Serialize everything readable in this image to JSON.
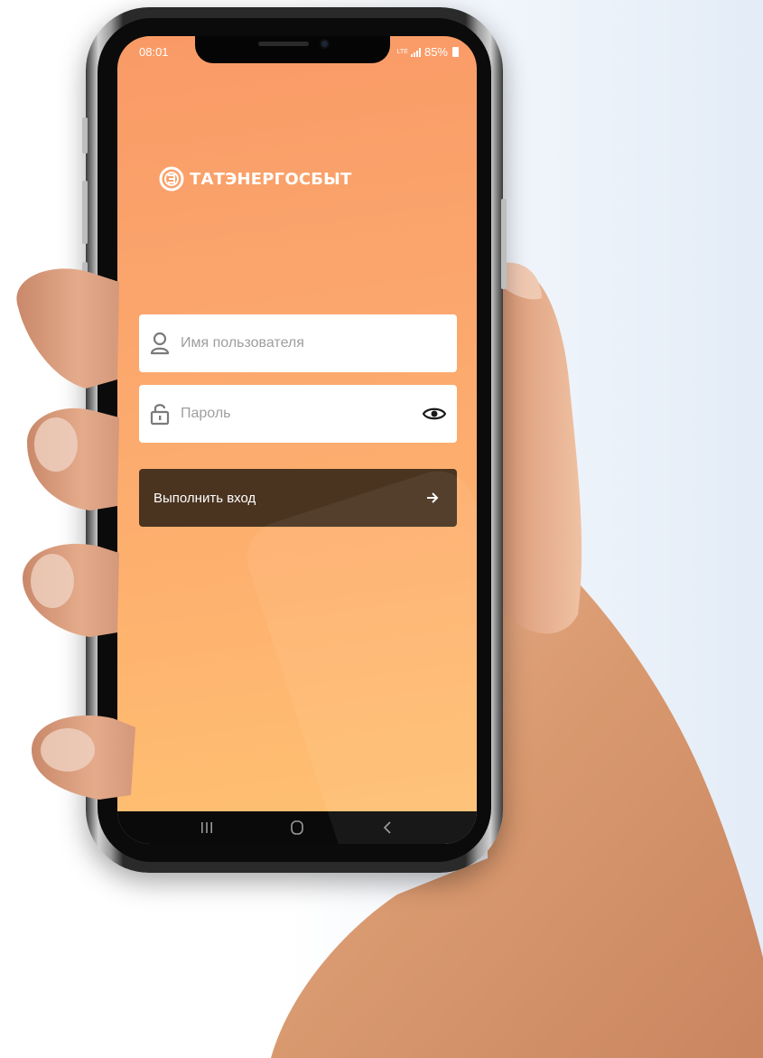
{
  "status_bar": {
    "time": "08:01",
    "network": "LTE",
    "battery": "85%"
  },
  "app": {
    "brand_name": "ТАТЭНЕРГОСБЫТ",
    "brand_color": "#f99a66",
    "logo_icon": "energy-e-logo-icon"
  },
  "login_form": {
    "username_placeholder": "Имя пользователя",
    "username_value": "",
    "password_placeholder": "Пароль",
    "password_value": "",
    "submit_label": "Выполнить вход",
    "submit_color": "#4a3420",
    "icons": {
      "username": "user-icon",
      "password": "lock-icon",
      "toggle_password": "eye-icon",
      "submit": "arrow-right-icon"
    }
  },
  "navigation_bar": {
    "buttons": [
      "recent-apps-icon",
      "home-icon",
      "back-icon"
    ]
  }
}
